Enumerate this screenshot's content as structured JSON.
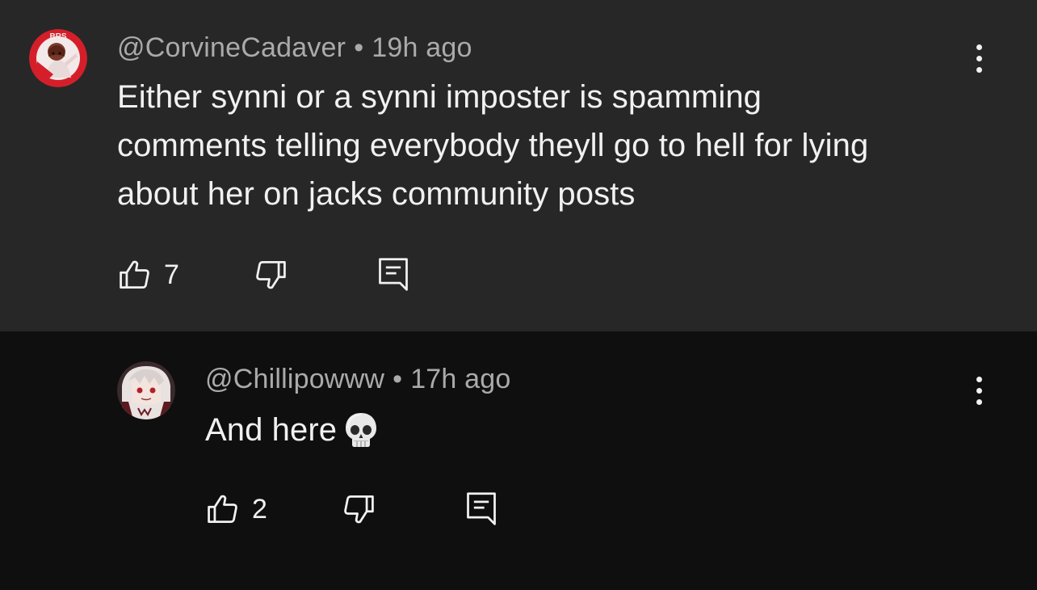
{
  "comments": [
    {
      "username": "@CorvineCadaver",
      "separator": "•",
      "time": "19h ago",
      "text_lines": [
        "Either synni or a synni imposter is spamming",
        "comments telling everybody theyll go to hell for lying",
        "about her on jacks community posts"
      ],
      "like_count": "7",
      "avatar_icon": "avatar-red-circle",
      "avatar_text": "BRS"
    },
    {
      "username": "@Chillipowww",
      "separator": "•",
      "time": "17h ago",
      "text": "And here",
      "emoji_icon": "skull-emoji-icon",
      "like_count": "2",
      "avatar_icon": "avatar-anime-character"
    }
  ],
  "colors": {
    "parent_background": "#272727",
    "page_background": "#0f0f0f",
    "text_primary": "#f1f1f1",
    "text_secondary": "#aaaaaa"
  }
}
